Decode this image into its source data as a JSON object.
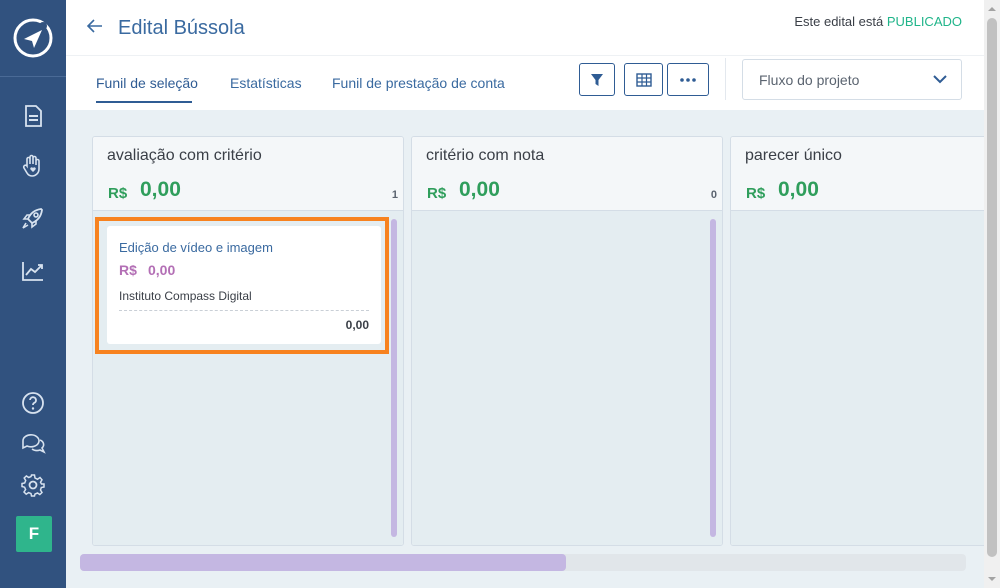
{
  "header": {
    "title": "Edital Bússola",
    "status_prefix": "Este edital está",
    "status_value": "PUBLICADO",
    "tabs": [
      {
        "label": "Funil de seleção"
      },
      {
        "label": "Estatísticas"
      },
      {
        "label": "Funil de prestação de conta"
      }
    ],
    "select": {
      "label": "Fluxo do projeto"
    }
  },
  "sidebar": {
    "icons": [
      "compass-logo-icon",
      "document-icon",
      "hand-heart-icon",
      "rocket-icon",
      "chart-trend-icon",
      "help-icon",
      "chat-icon",
      "gear-icon"
    ],
    "avatar": "F"
  },
  "columns": [
    {
      "title": "avaliação com critério",
      "currency": "R$",
      "amount": "0,00",
      "count": "1",
      "cards": [
        {
          "title": "Edição de vídeo e imagem",
          "currency": "R$",
          "amount": "0,00",
          "organization": "Instituto Compass Digital",
          "value": "0,00"
        }
      ]
    },
    {
      "title": "critério com nota",
      "currency": "R$",
      "amount": "0,00",
      "count": "0",
      "cards": []
    },
    {
      "title": "parecer único",
      "currency": "R$",
      "amount": "0,00",
      "count": "",
      "cards": []
    }
  ],
  "colors": {
    "sidebar": "#31527f",
    "accent": "#2f5c94",
    "published": "#20b58a",
    "amount": "#2f9e5c",
    "card_amount": "#b36fb5",
    "highlight": "#f7821f"
  }
}
